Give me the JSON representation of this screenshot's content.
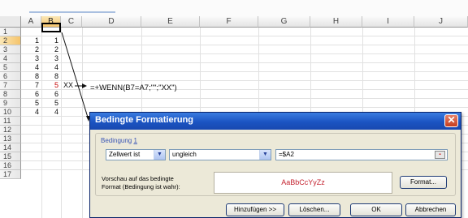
{
  "spreadsheet": {
    "columns": [
      "A",
      "B",
      "C",
      "D",
      "E",
      "F",
      "G",
      "H",
      "I",
      "J"
    ],
    "selected_column": "B",
    "rows": [
      "1",
      "2",
      "3",
      "4",
      "5",
      "6",
      "7",
      "8",
      "9",
      "10",
      "11",
      "12",
      "13",
      "14",
      "15",
      "16",
      "17"
    ],
    "selected_row": "2",
    "col_a_values": [
      "1",
      "2",
      "3",
      "4",
      "8",
      "7",
      "6",
      "5",
      "4"
    ],
    "col_b_values": [
      "1",
      "2",
      "3",
      "4",
      "8",
      "5",
      "6",
      "5",
      "4"
    ],
    "c7_text": "XX",
    "d7_formula": "=+WENN(B7=A7;\"\";\"XX\")"
  },
  "dialog": {
    "title": "Bedingte Formatierung",
    "close_glyph": "✕",
    "group_label_text": "Bedingung ",
    "group_label_number": "1",
    "condition_type": "Zellwert ist",
    "operator": "ungleich",
    "formula_value": "=$A2",
    "preview_label_line1": "Vorschau auf das bedingte",
    "preview_label_line2": "Format (Bedingung ist wahr):",
    "preview_sample": "AaBbCcYyZz",
    "format_button": "Format...",
    "add_button": "Hinzufügen >>",
    "delete_button": "Löschen...",
    "ok_button": "OK",
    "cancel_button": "Abbrechen"
  },
  "colors": {
    "title_bar": "#1b54c2",
    "preview_text": "#c4232f",
    "highlight_value": "#c40000"
  }
}
